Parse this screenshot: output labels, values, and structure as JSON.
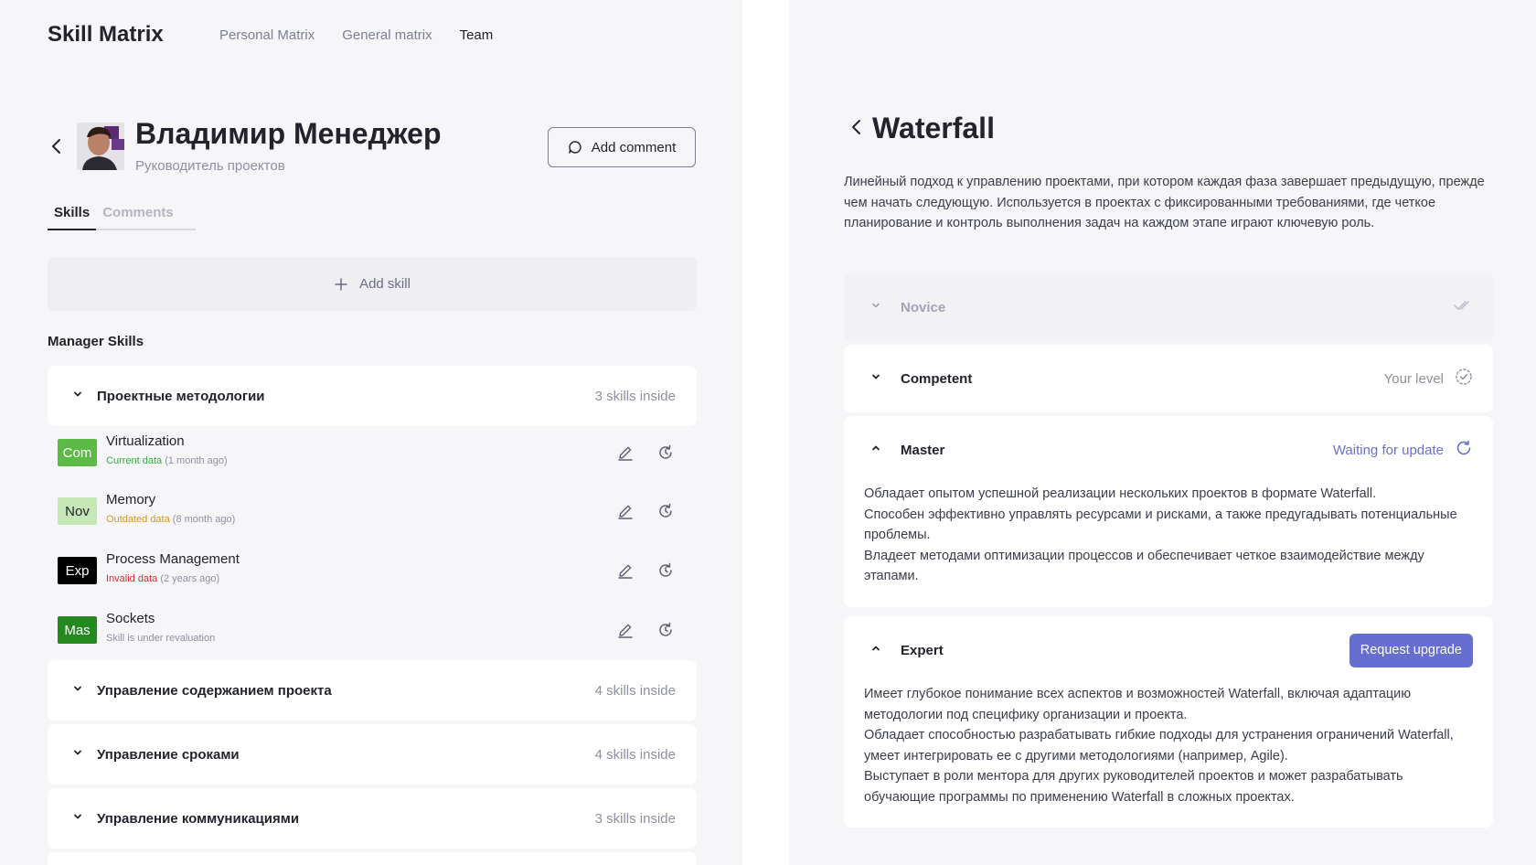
{
  "app": {
    "brand": "Skill Matrix",
    "nav": [
      "Personal Matrix",
      "General matrix",
      "Team"
    ],
    "nav_active_index": 2
  },
  "profile": {
    "name": "Владимир Менеджер",
    "role": "Руководитель проектов",
    "add_comment_label": "Add comment"
  },
  "tabs": [
    {
      "label": "Skills",
      "active": true
    },
    {
      "label": "Comments",
      "active": false
    }
  ],
  "add_skill_label": "Add skill",
  "section_title": "Manager Skills",
  "groups": [
    {
      "title": "Проектные методологии",
      "count": "3 skills inside",
      "expanded": true
    },
    {
      "title": "Управление содержанием проекта",
      "count": "4 skills inside",
      "expanded": false
    },
    {
      "title": "Управление сроками",
      "count": "4 skills inside",
      "expanded": false
    },
    {
      "title": "Управление коммуникациями",
      "count": "3 skills inside",
      "expanded": false
    }
  ],
  "skills": [
    {
      "badge": "Com",
      "badge_bg": "#5cbb46",
      "badge_fg": "#ffffff",
      "name": "Virtualization",
      "status": "Current data",
      "status_color": "#35a642",
      "age": "(1 month ago)"
    },
    {
      "badge": "Nov",
      "badge_bg": "#c6e8b6",
      "badge_fg": "#22232b",
      "name": "Memory",
      "status": "Outdated data",
      "status_color": "#d49a10",
      "age": "(8 month ago)"
    },
    {
      "badge": "Exp",
      "badge_bg": "#000000",
      "badge_fg": "#ffffff",
      "name": "Process Management",
      "status": "Invalid data",
      "status_color": "#d52d2d",
      "age": "(2 years ago)"
    },
    {
      "badge": "Mas",
      "badge_bg": "#248a1f",
      "badge_fg": "#ffffff",
      "name": "Sockets",
      "status": "Skill is under revaluation",
      "status_color": "#8e90a0",
      "age": ""
    }
  ],
  "detail": {
    "title": "Waterfall",
    "description": "Линейный подход к управлению проектами, при котором каждая фаза завершает предыдущую, прежде чем начать следующую. Используется в проектах с фиксированными требованиями, где четкое планирование и контроль выполнения задач на каждом этапе играют ключевую роль.",
    "levels": [
      {
        "name": "Novice",
        "status": "",
        "faded": true
      },
      {
        "name": "Competent",
        "status": "Your level"
      },
      {
        "name": "Master",
        "status": "Waiting for update",
        "lines": [
          "Обладает опытом успешной реализации нескольких проектов в формате Waterfall.",
          "Способен эффективно управлять ресурсами и рисками, а также предугадывать потенциальные проблемы.",
          "Владеет методами оптимизации процессов и обеспечивает четкое взаимодействие между этапами."
        ]
      },
      {
        "name": "Expert",
        "action": "Request upgrade",
        "lines": [
          "Имеет глубокое понимание всех аспектов и возможностей Waterfall, включая адаптацию методологии под специфику организации и проекта.",
          "Обладает способностью разрабатывать гибкие подходы для устранения ограничений Waterfall, умеет интегрировать ее с другими методологиями (например, Agile).",
          "Выступает в роли ментора для других руководителей проектов и может разрабатывать обучающие программы по применению Waterfall в сложных проектах."
        ]
      }
    ]
  },
  "colors": {
    "accent": "#666ed0",
    "background": "#f6f6f8",
    "card": "#ffffff"
  }
}
